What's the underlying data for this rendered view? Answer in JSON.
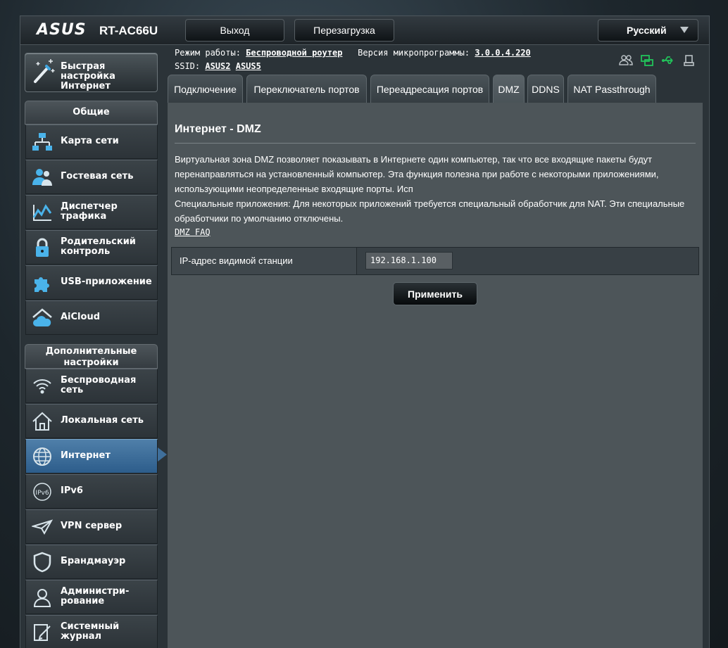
{
  "header": {
    "brand": "ASUS",
    "model": "RT-AC66U",
    "logout_label": "Выход",
    "reboot_label": "Перезагрузка",
    "language": "Русский"
  },
  "info": {
    "mode_label": "Режим работы:",
    "mode_value": "Беспроводной роутер",
    "firmware_label": "Версия микропрограммы:",
    "firmware_value": "3.0.0.4.220",
    "ssid_label": "SSID:",
    "ssid_values": [
      "ASUS2",
      "ASUS5"
    ]
  },
  "sidebar": {
    "quick_setup": "Быстрая настройка Интернет",
    "general_title": "Общие",
    "general_items": [
      {
        "icon": "network-map-icon",
        "label": "Карта сети"
      },
      {
        "icon": "guest-network-icon",
        "label": "Гостевая сеть"
      },
      {
        "icon": "traffic-manager-icon",
        "label": "Диспетчер трафика"
      },
      {
        "icon": "parental-control-icon",
        "label": "Родительский контроль"
      },
      {
        "icon": "usb-app-icon",
        "label": "USB-приложение"
      },
      {
        "icon": "aicloud-icon",
        "label": "AiCloud"
      }
    ],
    "advanced_title": "Дополнительные настройки",
    "advanced_items": [
      {
        "icon": "wireless-icon",
        "label": "Беспроводная сеть"
      },
      {
        "icon": "lan-icon",
        "label": "Локальная сеть"
      },
      {
        "icon": "internet-globe-icon",
        "label": "Интернет",
        "active": true
      },
      {
        "icon": "ipv6-icon",
        "label": "IPv6"
      },
      {
        "icon": "vpn-server-icon",
        "label": "VPN сервер"
      },
      {
        "icon": "firewall-icon",
        "label": "Брандмауэр"
      },
      {
        "icon": "administration-icon",
        "label": "Администри-рование"
      },
      {
        "icon": "system-log-icon",
        "label": "Системный журнал"
      }
    ]
  },
  "tabs": [
    "Подключение",
    "Переключатель портов",
    "Переадресация портов",
    "DMZ",
    "DDNS",
    "NAT Passthrough"
  ],
  "active_tab": "DMZ",
  "main": {
    "title": "Интернет - DMZ",
    "desc_lines": [
      "Виртуальная зона DMZ позволяет показывать в Интернете один компьютер, так что все входящие пакеты будут",
      "перенаправляться на установленный компьютер. Эта функция полезна при работе с некоторыми приложениями,",
      "использующими неопределенные входящие порты. Исп",
      "Специальные приложения: Для некоторых приложений требуется специальный обработчик для NAT. Эти специальные",
      "обработчики по умолчанию отключены."
    ],
    "faq_link": "DMZ FAQ",
    "field_label": "IP-адрес видимой станции",
    "field_value": "192.168.1.100",
    "apply_label": "Применить"
  },
  "colors": {
    "active_item": "#3f6f9b",
    "status_green": "#22c25a",
    "status_gray": "#b9c0c4"
  }
}
